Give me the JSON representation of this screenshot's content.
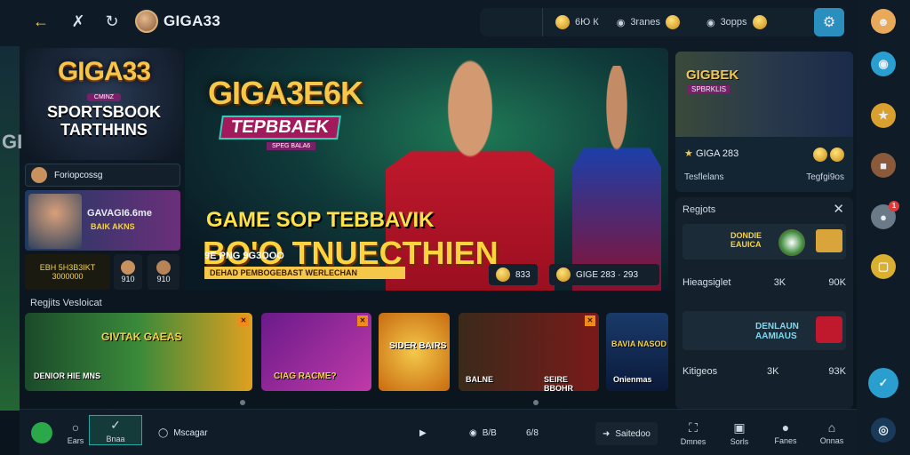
{
  "topbar": {
    "brand": "GIGA33",
    "stat1": "6Ю К",
    "stat2": "3ranes",
    "stat3": "3opps"
  },
  "banner_left": {
    "title": "GIGA33",
    "badge": "CMINZ",
    "subtitle": "SPORTSBOOK TARTHHNS",
    "row_label": "Foriopcossg",
    "promo_title": "GAVAGI6.6me",
    "promo_sub": "BAIK AKNS",
    "mini1": "EBH 5H3B3IKT 3000000",
    "mini2": "910",
    "mini3": "910"
  },
  "hero": {
    "title": "GIGA3E6K",
    "subtitle": "TEPBBAEK",
    "tag": "SPEG BALA6",
    "headline1": "GAME SOP TEBBAVIK",
    "headline2": "BO'O TNUECTHIEN",
    "line1": "9E PNG 9G3OOO",
    "bar": "DEHAD PEMBOGEBAST WERLECHAN",
    "stat_left": "833",
    "stat_right": "GIGE 283 · 293"
  },
  "right_card": {
    "title": "GIGBEK",
    "subtitle": "SPBRKLIS",
    "row1_label": "GIGA 283",
    "row2_left": "Tesflelans",
    "row2_right": "Tegfgi9os"
  },
  "right_panel": {
    "header": "Regjots",
    "game1_label": "DONDIE EAUICA",
    "row1": [
      "Hieagsiglet",
      "3K",
      "90K"
    ],
    "game2_label": "DENLAUN AAMIAUS",
    "row2": [
      "Kitigeos",
      "3K",
      "93K"
    ]
  },
  "section": {
    "title": "Regjits Vesloicat",
    "tiles": [
      {
        "label": "GIVTAK GAEAS",
        "sub": "DENIOR HIE MNS"
      },
      {
        "label": "CIAG RACME?",
        "sub": ""
      },
      {
        "label": "SIDER BAIRS",
        "sub": ""
      },
      {
        "label": "BALNE",
        "sub": "SEIRE BBOHR"
      },
      {
        "label": "BAVIA NASOD",
        "sub": "Onienmas"
      }
    ]
  },
  "bottombar": {
    "item1": "Ears",
    "item2": "Bnaa",
    "item3": "Mscagar",
    "item4": "B/B",
    "item5": "6/8",
    "item6": "Saitedoo",
    "nav": [
      "Dmnes",
      "Sorls",
      "Fanes",
      "Onnas"
    ]
  },
  "rail": {
    "badge": "1"
  },
  "leftstrip_label": "GI"
}
